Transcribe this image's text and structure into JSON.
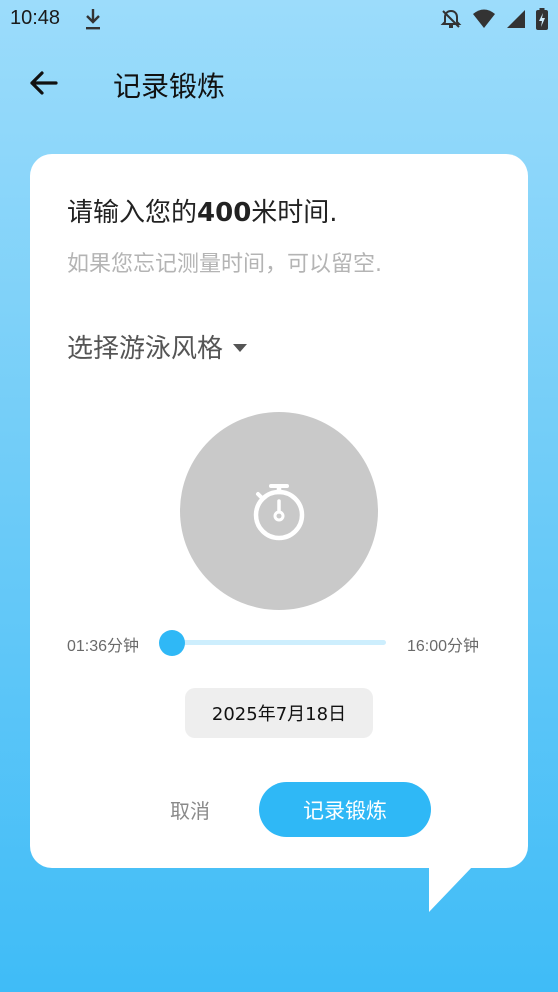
{
  "status_bar": {
    "time": "10:48",
    "icons": [
      "download-icon",
      "bell-off-icon",
      "wifi-icon",
      "signal-icon",
      "battery-charging-icon"
    ]
  },
  "appbar": {
    "title": "记录锻炼",
    "back_icon": "arrow-left-icon"
  },
  "dialog": {
    "prompt_prefix": "请输入您的",
    "prompt_distance": "400",
    "prompt_suffix": "米时间.",
    "hint": "如果您忘记测量时间，可以留空.",
    "style_selector_label": "选择游泳风格",
    "timer_icon": "stopwatch-icon",
    "slider": {
      "min_label": "01:36分钟",
      "max_label": "16:00分钟",
      "value_fraction": 0
    },
    "date": "2025年7月18日",
    "cancel_label": "取消",
    "submit_label": "记录锻炼"
  },
  "colors": {
    "accent": "#2fb8f6",
    "slider_track": "#cdeefd",
    "timer_circle": "#c9c9c9",
    "card": "#ffffff"
  }
}
